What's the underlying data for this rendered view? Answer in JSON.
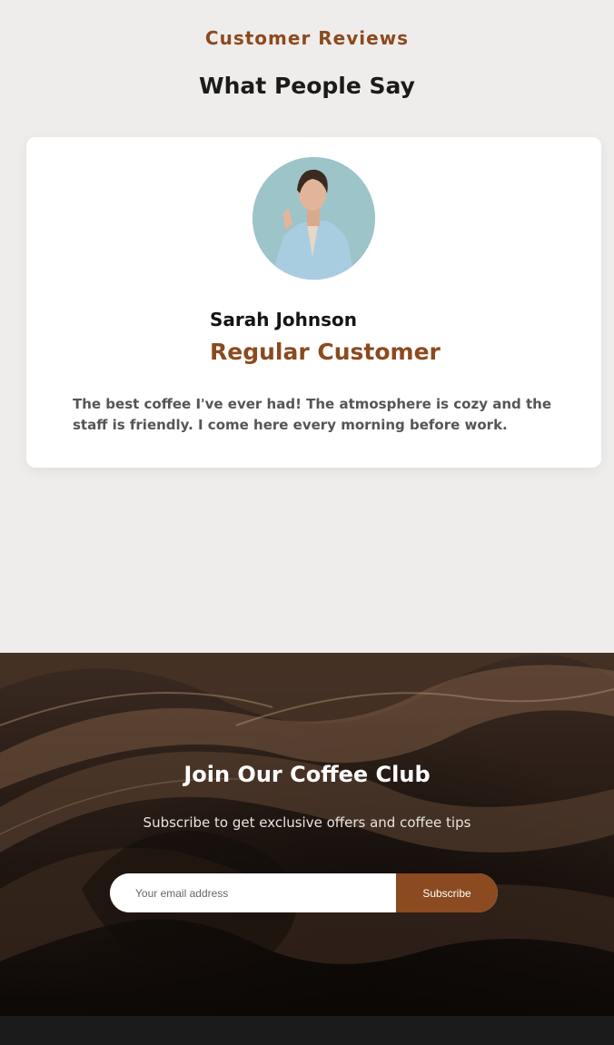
{
  "reviews": {
    "eyebrow": "Customer Reviews",
    "heading": "What People Say",
    "testimonial": {
      "name": "Sarah Johnson",
      "role": "Regular Customer",
      "quote": "The best coffee I've ever had! The atmosphere is cozy and the staff is friendly. I come here every morning before work."
    }
  },
  "newsletter": {
    "title": "Join Our Coffee Club",
    "subtitle": "Subscribe to get exclusive offers and coffee tips",
    "email_placeholder": "Your email address",
    "subscribe_label": "Subscribe"
  },
  "colors": {
    "accent": "#8b4a1f",
    "page_background": "#efedeb",
    "footer": "#1b1b1b"
  }
}
